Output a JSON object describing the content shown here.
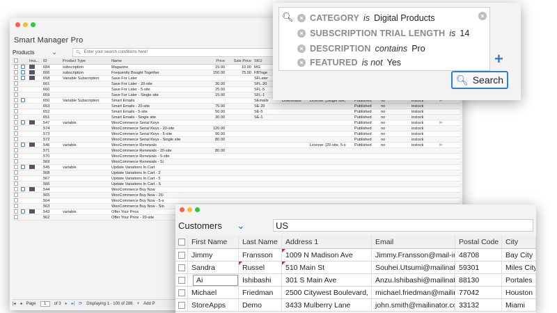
{
  "main": {
    "title": "Smart Manager Pro",
    "dashboard": "Products",
    "search_placeholder": "Enter your search conditions here!",
    "columns": [
      "Ima...",
      "ID",
      "Product Type",
      "Name",
      "Price",
      "Sale Price",
      "SKU"
    ],
    "rows": [
      {
        "id": "684",
        "type": "subscription",
        "name": "Magazine",
        "price": "15.00",
        "sale": "10.00",
        "sku": "MG",
        "dl": "",
        "lic": "",
        "pub": "",
        "feat": "",
        "stock": "",
        "ico": "edit",
        "img": true
      },
      {
        "id": "666",
        "type": "subscription",
        "name": "Frequently Bought Together",
        "price": "150.00",
        "sale": "75.00",
        "sku": "FBToge",
        "dl": "",
        "lic": "",
        "pub": "",
        "feat": "",
        "stock": "",
        "ico": "edit",
        "img": true
      },
      {
        "id": "658",
        "type": "Variable Subscription",
        "name": "Save For Later",
        "price": "",
        "sale": "",
        "sku": "SFLater",
        "dl": "",
        "lic": "",
        "pub": "",
        "feat": "",
        "stock": "",
        "ico": "edit",
        "img": true
      },
      {
        "id": "661",
        "type": "",
        "name": "Save For Later - 20-site",
        "price": "30.00",
        "sale": "",
        "sku": "SFL-20",
        "dl": "",
        "lic": "",
        "pub": "Published",
        "feat": "no",
        "stock": "instock",
        "ico": "",
        "img": false
      },
      {
        "id": "660",
        "type": "",
        "name": "Save For Later - 5-site",
        "price": "25.00",
        "sale": "",
        "sku": "SFL-5",
        "dl": "",
        "lic": "",
        "pub": "Published",
        "feat": "no",
        "stock": "instock",
        "ico": "",
        "img": false
      },
      {
        "id": "659",
        "type": "",
        "name": "Save For Later - Single site",
        "price": "15.00",
        "sale": "",
        "sku": "SFL-1",
        "dl": "",
        "lic": "",
        "pub": "Published",
        "feat": "no",
        "stock": "instock",
        "ico": "",
        "img": false
      },
      {
        "id": "650",
        "type": "Variable Subscription",
        "name": "Smart Emails",
        "price": "",
        "sale": "",
        "sku": "SEmails",
        "dl": "Downloads",
        "lic": "License: [Single site,",
        "pub": "Published",
        "feat": "no",
        "stock": "instock",
        "ico": "edit",
        "img": false
      },
      {
        "id": "653",
        "type": "",
        "name": "Smart Emails - 20-site",
        "price": "75.00",
        "sale": "",
        "sku": "SE-20",
        "dl": "",
        "lic": "",
        "pub": "Published",
        "feat": "no",
        "stock": "instock",
        "ico": "",
        "img": false
      },
      {
        "id": "652",
        "type": "",
        "name": "Smart Emails - 5-site",
        "price": "50.00",
        "sale": "",
        "sku": "SE-5",
        "dl": "",
        "lic": "",
        "pub": "Published",
        "feat": "no",
        "stock": "instock",
        "ico": "",
        "img": false
      },
      {
        "id": "651",
        "type": "",
        "name": "Smart Emails - Single site",
        "price": "30.00",
        "sale": "",
        "sku": "SE-1",
        "dl": "",
        "lic": "",
        "pub": "Published",
        "feat": "no",
        "stock": "instock",
        "ico": "",
        "img": false
      },
      {
        "id": "547",
        "type": "variable",
        "name": "WooCommerce Serial Keys",
        "price": "",
        "sale": "",
        "sku": "",
        "dl": "",
        "lic": "",
        "pub": "Published",
        "feat": "no",
        "stock": "instock",
        "ico": "edit",
        "img": true
      },
      {
        "id": "574",
        "type": "",
        "name": "WooCommerce Serial Keys - 20-site",
        "price": "120.00",
        "sale": "",
        "sku": "",
        "dl": "",
        "lic": "",
        "pub": "Published",
        "feat": "no",
        "stock": "instock",
        "ico": "",
        "img": false
      },
      {
        "id": "573",
        "type": "",
        "name": "WooCommerce Serial Keys - 5-site",
        "price": "90.00",
        "sale": "",
        "sku": "",
        "dl": "",
        "lic": "",
        "pub": "Published",
        "feat": "no",
        "stock": "instock",
        "ico": "",
        "img": false
      },
      {
        "id": "572",
        "type": "",
        "name": "WooCommerce Serial Keys - Single site",
        "price": "80.00",
        "sale": "",
        "sku": "",
        "dl": "",
        "lic": "",
        "pub": "Published",
        "feat": "no",
        "stock": "instock",
        "ico": "",
        "img": false
      },
      {
        "id": "546",
        "type": "variable",
        "name": "WooCommerce Renewals",
        "price": "",
        "sale": "",
        "sku": "",
        "dl": "",
        "lic": "License: [20-site, 5-s",
        "pub": "Published",
        "feat": "no",
        "stock": "instock",
        "ico": "edit",
        "img": true
      },
      {
        "id": "571",
        "type": "",
        "name": "WooCommerce Renewals - 20-site",
        "price": "80.00",
        "sale": "",
        "sku": "",
        "dl": "",
        "lic": "",
        "pub": "",
        "feat": "",
        "stock": "",
        "ico": "",
        "img": false
      },
      {
        "id": "570",
        "type": "",
        "name": "WooCommerce Renewals - 5-site",
        "price": "",
        "sale": "",
        "sku": "",
        "dl": "",
        "lic": "",
        "pub": "",
        "feat": "",
        "stock": "",
        "ico": "",
        "img": false
      },
      {
        "id": "569",
        "type": "",
        "name": "WooCommerce Renewals - Si",
        "price": "",
        "sale": "",
        "sku": "",
        "dl": "",
        "lic": "",
        "pub": "",
        "feat": "",
        "stock": "",
        "ico": "",
        "img": false
      },
      {
        "id": "545",
        "type": "variable",
        "name": "Update Variations In Cart",
        "price": "",
        "sale": "",
        "sku": "",
        "dl": "",
        "lic": "",
        "pub": "",
        "feat": "",
        "stock": "",
        "ico": "edit",
        "img": true
      },
      {
        "id": "568",
        "type": "",
        "name": "Update Variations In Cart - 2",
        "price": "",
        "sale": "",
        "sku": "",
        "dl": "",
        "lic": "",
        "pub": "",
        "feat": "",
        "stock": "",
        "ico": "",
        "img": false
      },
      {
        "id": "567",
        "type": "",
        "name": "Update Variations In Cart - 5",
        "price": "",
        "sale": "",
        "sku": "",
        "dl": "",
        "lic": "",
        "pub": "",
        "feat": "",
        "stock": "",
        "ico": "",
        "img": false
      },
      {
        "id": "566",
        "type": "",
        "name": "Update Variations In Cart - S",
        "price": "",
        "sale": "",
        "sku": "",
        "dl": "",
        "lic": "",
        "pub": "",
        "feat": "",
        "stock": "",
        "ico": "",
        "img": false
      },
      {
        "id": "544",
        "type": "",
        "name": "WooCommerce Buy Now",
        "price": "",
        "sale": "",
        "sku": "",
        "dl": "",
        "lic": "",
        "pub": "",
        "feat": "",
        "stock": "",
        "ico": "edit",
        "img": true
      },
      {
        "id": "565",
        "type": "",
        "name": "WooCommerce Buy Now - 20-",
        "price": "",
        "sale": "",
        "sku": "",
        "dl": "",
        "lic": "",
        "pub": "",
        "feat": "",
        "stock": "",
        "ico": "",
        "img": false
      },
      {
        "id": "564",
        "type": "",
        "name": "WooCommerce Buy Now - 5-s",
        "price": "",
        "sale": "",
        "sku": "",
        "dl": "",
        "lic": "",
        "pub": "",
        "feat": "",
        "stock": "",
        "ico": "",
        "img": false
      },
      {
        "id": "563",
        "type": "",
        "name": "WooCommerce Buy Now - Sin",
        "price": "",
        "sale": "",
        "sku": "",
        "dl": "",
        "lic": "",
        "pub": "",
        "feat": "",
        "stock": "",
        "ico": "",
        "img": false
      },
      {
        "id": "543",
        "type": "variable",
        "name": "Offer Your Price",
        "price": "",
        "sale": "",
        "sku": "",
        "dl": "",
        "lic": "",
        "pub": "",
        "feat": "",
        "stock": "",
        "ico": "edit",
        "img": true
      },
      {
        "id": "562",
        "type": "",
        "name": "Offer Your Price - 20-site",
        "price": "",
        "sale": "",
        "sku": "",
        "dl": "",
        "lic": "",
        "pub": "",
        "feat": "",
        "stock": "",
        "ico": "",
        "img": false
      }
    ],
    "status": {
      "page_label": "Page",
      "page": "1",
      "of": "of 3",
      "display": "Displaying 1 - 100 of 286",
      "add": "Add P"
    }
  },
  "search": {
    "conditions": [
      {
        "field": "CATEGORY",
        "op": "is",
        "value": "Digital Products"
      },
      {
        "field": "SUBSCRIPTION TRIAL LENGTH",
        "op": "is",
        "value": "14"
      },
      {
        "field": "DESCRIPTION",
        "op": "contains",
        "value": "Pro"
      },
      {
        "field": "FEATURED",
        "op": "is not",
        "value": "Yes"
      }
    ],
    "button": "Search"
  },
  "customers": {
    "dashboard": "Customers",
    "query": "US",
    "columns": [
      "First Name",
      "Last Name",
      "Address 1",
      "Email",
      "Postal Code",
      "City"
    ],
    "rows": [
      {
        "first": "Jimmy",
        "last": "Fransson",
        "addr": "1009 N Madison Ave",
        "email": "Jimmy.Fransson@mail-in",
        "zip": "48708",
        "city": "Bay City",
        "flag_last": false,
        "flag_addr": true
      },
      {
        "first": "Sandra",
        "last": "Russel",
        "addr": "510 Main St",
        "email": "Souhei.Utsumi@mailinato",
        "zip": "59301",
        "city": "Miles City",
        "flag_last": true,
        "flag_addr": true
      },
      {
        "first": "Ai",
        "last": "Ishibashi",
        "addr": "301 S Main Ave",
        "email": "Anzu.Ishibashi@mailinato",
        "zip": "88130",
        "city": "Portales",
        "flag_last": false,
        "flag_addr": false
      },
      {
        "first": "Michael",
        "last": "Friedman",
        "addr": "2500 Citywest Boulevard,",
        "email": "michael.friedman@mailin",
        "zip": "77042",
        "city": "Houston",
        "flag_last": false,
        "flag_addr": false
      },
      {
        "first": "StoreApps",
        "last": "Demo",
        "addr": "3433 Mulberry Lane",
        "email": "john.smith@mailinator.com",
        "zip": "33132",
        "city": "Miami",
        "flag_last": false,
        "flag_addr": false
      }
    ]
  }
}
